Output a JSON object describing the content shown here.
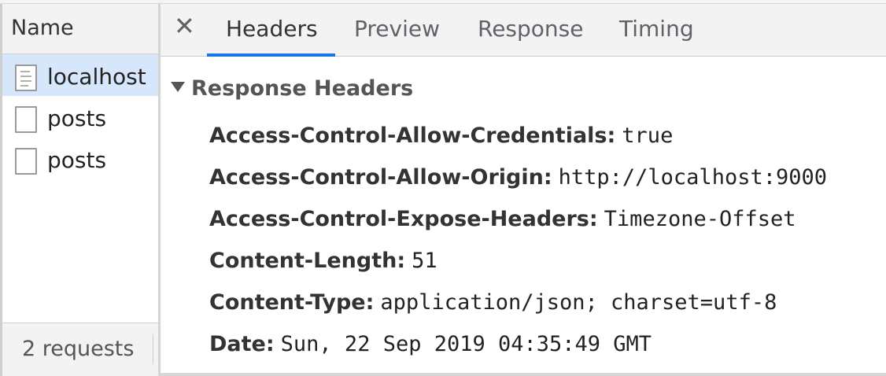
{
  "sidebar": {
    "column_header": "Name",
    "requests": [
      {
        "name": "localhost",
        "selected": true
      },
      {
        "name": "posts",
        "selected": false
      },
      {
        "name": "posts",
        "selected": false
      }
    ],
    "summary": "2 requests"
  },
  "tabs": {
    "close_symbol": "✕",
    "items": [
      "Headers",
      "Preview",
      "Response",
      "Timing"
    ],
    "active": "Headers"
  },
  "response_headers": {
    "title": "Response Headers",
    "rows": [
      {
        "name": "Access-Control-Allow-Credentials:",
        "value": "true"
      },
      {
        "name": "Access-Control-Allow-Origin:",
        "value": "http://localhost:9000"
      },
      {
        "name": "Access-Control-Expose-Headers:",
        "value": "Timezone-Offset"
      },
      {
        "name": "Content-Length:",
        "value": "51"
      },
      {
        "name": "Content-Type:",
        "value": "application/json; charset=utf-8"
      },
      {
        "name": "Date:",
        "value": "Sun, 22 Sep 2019 04:35:49 GMT"
      }
    ]
  },
  "colors": {
    "accent": "#1a73e8",
    "selected_row": "#d6e7fb"
  }
}
